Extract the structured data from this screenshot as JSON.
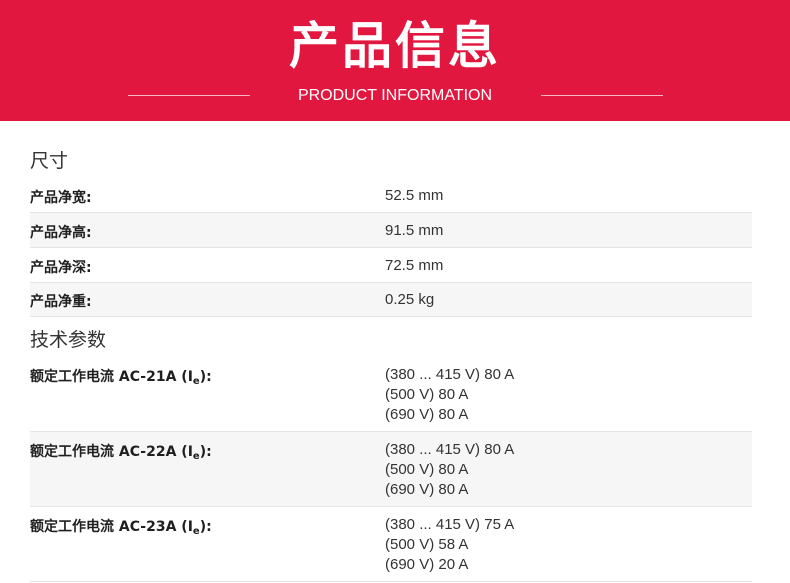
{
  "header": {
    "title": "产品信息",
    "subtitle": "PRODUCT INFORMATION",
    "background_color": "#e1173f"
  },
  "dimensions": {
    "title": "尺寸",
    "rows": [
      {
        "label": "产品净宽:",
        "value": "52.5 mm"
      },
      {
        "label": "产品净高:",
        "value": "91.5 mm"
      },
      {
        "label": "产品净深:",
        "value": "72.5 mm"
      },
      {
        "label": "产品净重:",
        "value": "0.25 kg"
      }
    ]
  },
  "technical": {
    "title": "技术参数",
    "rows": [
      {
        "label": "额定工作电流 AC-21A (I",
        "subscript": "e",
        "label_end": "):",
        "values": [
          "(380 ... 415 V) 80 A",
          "(500 V) 80 A",
          "(690 V) 80 A"
        ]
      },
      {
        "label": "额定工作电流 AC-22A (I",
        "subscript": "e",
        "label_end": "):",
        "values": [
          "(380 ... 415 V) 80 A",
          "(500 V) 80 A",
          "(690 V) 80 A"
        ]
      },
      {
        "label": "额定工作电流 AC-23A (I",
        "subscript": "e",
        "label_end": "):",
        "values": [
          "(380 ... 415 V) 75 A",
          "(500 V) 58 A",
          "(690 V) 20 A"
        ]
      }
    ]
  }
}
